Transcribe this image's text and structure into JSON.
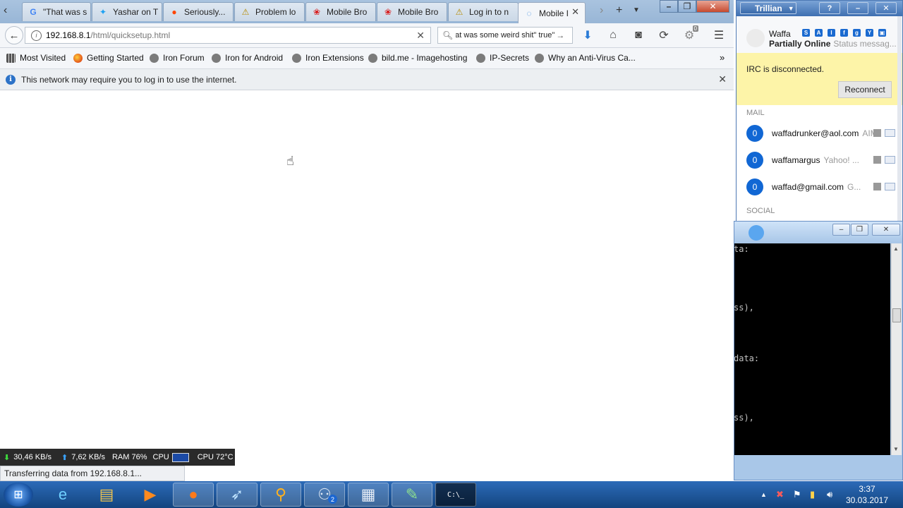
{
  "browser": {
    "tabs": [
      {
        "title": "\"That was s",
        "icon": "google-icon"
      },
      {
        "title": "Yashar on T",
        "icon": "twitter-icon"
      },
      {
        "title": "Seriously...",
        "icon": "reddit-icon"
      },
      {
        "title": "Problem lo",
        "icon": "warning-icon"
      },
      {
        "title": "Mobile Bro",
        "icon": "huawei-icon"
      },
      {
        "title": "Mobile Bro",
        "icon": "huawei-icon"
      },
      {
        "title": "Log in to n",
        "icon": "warning-icon"
      },
      {
        "title": "Mobile I",
        "icon": "loading-icon",
        "active": true
      }
    ],
    "url_host": "192.168.8.1",
    "url_path": "/html/quicksetup.html",
    "search_value": "\"That was some weird shit\" true",
    "download_count": "0",
    "bookmarks": [
      "Most Visited",
      "Getting Started",
      "Iron Forum",
      "Iron for Android",
      "Iron Extensions",
      "bild.me - Imagehosting",
      "IP-Secrets",
      "Why an Anti-Virus Ca..."
    ],
    "notification": "This network may require you to log in to use the internet.",
    "status_text": "Transferring data from 192.168.8.1...",
    "netmeter": {
      "down": "30,46 KB/s",
      "up": "7,62 KB/s",
      "ram": "RAM 76%",
      "cpu_label": "CPU",
      "cpu_temp": "CPU 72°C"
    }
  },
  "trillian": {
    "title": "Trillian",
    "user": "Waffa",
    "status": "Partially Online",
    "status_msg": "Status messag...",
    "irc_text": "IRC is disconnected.",
    "reconnect_label": "Reconnect",
    "mail_header": "MAIL",
    "social_header": "SOCIAL",
    "accounts": [
      {
        "count": "0",
        "name": "waffadrunker@aol.com",
        "type": "AIM"
      },
      {
        "count": "0",
        "name": "waffamargus",
        "type": "Yahoo! ..."
      },
      {
        "count": "0",
        "name": "waffad@gmail.com",
        "type": "G..."
      }
    ]
  },
  "console": {
    "lines": [
      "ta:",
      "ss),",
      "data:",
      "ss),"
    ]
  },
  "taskbar": {
    "time": "3:37",
    "date": "30.03.2017",
    "badge": "2"
  },
  "colors": {
    "taskbar": "#1c5394",
    "accent": "#1167d4",
    "irc_banner": "#fdf4a8"
  }
}
